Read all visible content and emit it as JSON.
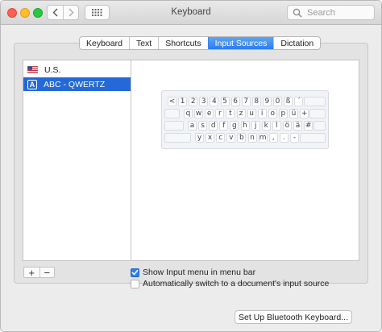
{
  "window": {
    "title": "Keyboard"
  },
  "search": {
    "placeholder": "Search"
  },
  "tabs": [
    {
      "label": "Keyboard",
      "active": false
    },
    {
      "label": "Text",
      "active": false
    },
    {
      "label": "Shortcuts",
      "active": false
    },
    {
      "label": "Input Sources",
      "active": true
    },
    {
      "label": "Dictation",
      "active": false
    }
  ],
  "sources": [
    {
      "label": "U.S.",
      "icon": "us-flag-icon",
      "selected": false
    },
    {
      "label": "ABC - QWERTZ",
      "icon": "abc-badge-icon",
      "selected": true
    }
  ],
  "keyboard_rows": [
    [
      "<",
      "1",
      "2",
      "3",
      "4",
      "5",
      "6",
      "7",
      "8",
      "9",
      "0",
      "ß",
      "´"
    ],
    [
      "q",
      "w",
      "e",
      "r",
      "t",
      "z",
      "u",
      "i",
      "o",
      "p",
      "ü",
      "+"
    ],
    [
      "a",
      "s",
      "d",
      "f",
      "g",
      "h",
      "j",
      "k",
      "l",
      "ö",
      "ä",
      "#"
    ],
    [
      "y",
      "x",
      "c",
      "v",
      "b",
      "n",
      "m",
      ",",
      ".",
      "-"
    ]
  ],
  "list_controls": {
    "add": "+",
    "remove": "−"
  },
  "options": {
    "show_input_menu": {
      "label": "Show Input menu in menu bar",
      "checked": true
    },
    "auto_switch": {
      "label": "Automatically switch to a document's input source",
      "checked": false
    }
  },
  "bluetooth_button": "Set Up Bluetooth Keyboard...",
  "colors": {
    "accent": "#2469d7",
    "tab_active": "#2b7cf0"
  }
}
